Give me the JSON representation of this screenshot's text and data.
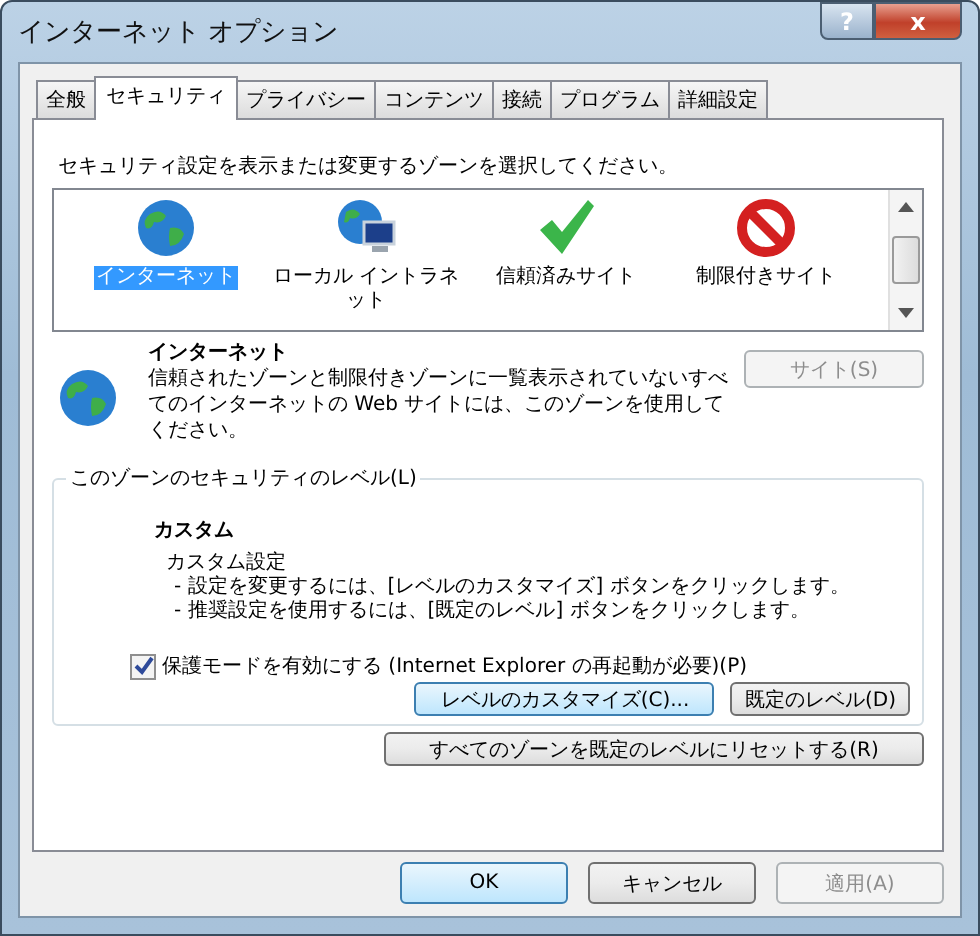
{
  "window": {
    "title": "インターネット オプション",
    "help_button": "?",
    "close_button": "x"
  },
  "tabs": [
    {
      "label": "全般",
      "selected": false
    },
    {
      "label": "セキュリティ",
      "selected": true
    },
    {
      "label": "プライバシー",
      "selected": false
    },
    {
      "label": "コンテンツ",
      "selected": false
    },
    {
      "label": "接続",
      "selected": false
    },
    {
      "label": "プログラム",
      "selected": false
    },
    {
      "label": "詳細設定",
      "selected": false
    }
  ],
  "zone_prompt": "セキュリティ設定を表示または変更するゾーンを選択してください。",
  "zones": [
    {
      "label": "インターネット",
      "kind": "globe",
      "selected": true
    },
    {
      "label": "ローカル イントラネット",
      "kind": "intranet",
      "selected": false
    },
    {
      "label": "信頼済みサイト",
      "kind": "trusted",
      "selected": false
    },
    {
      "label": "制限付きサイト",
      "kind": "restricted",
      "selected": false
    }
  ],
  "zone_info": {
    "title": "インターネット",
    "description": "信頼されたゾーンと制限付きゾーンに一覧表示されていないすべてのインターネットの Web サイトには、このゾーンを使用してください。",
    "sites_button": {
      "label": "サイト(S)",
      "disabled": true
    }
  },
  "security_level": {
    "legend": "このゾーンのセキュリティのレベル(L)",
    "level_name": "カスタム",
    "level_desc": "カスタム設定",
    "notes": [
      "- 設定を変更するには、[レベルのカスタマイズ] ボタンをクリックします。",
      "- 推奨設定を使用するには、[既定のレベル] ボタンをクリックします。"
    ],
    "protected_mode": {
      "label": "保護モードを有効にする (Internet Explorer の再起動が必要)(P)",
      "checked": true
    },
    "buttons": [
      {
        "label": "レベルのカスタマイズ(C)...",
        "focused": true
      },
      {
        "label": "既定のレベル(D)",
        "focused": false
      }
    ]
  },
  "reset_button": "すべてのゾーンを既定のレベルにリセットする(R)",
  "buttons": [
    {
      "label": "OK",
      "default": true,
      "disabled": false
    },
    {
      "label": "キャンセル",
      "default": false,
      "disabled": false
    },
    {
      "label": "適用(A)",
      "default": false,
      "disabled": true
    }
  ]
}
